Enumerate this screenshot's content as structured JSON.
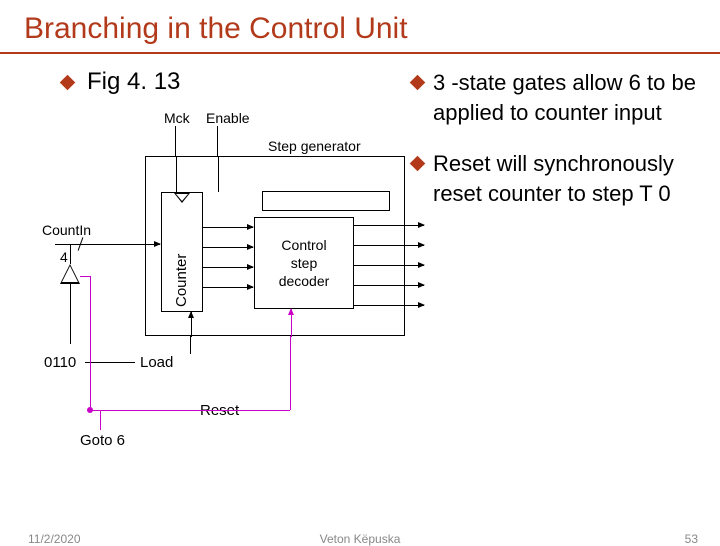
{
  "title": "Branching in the Control Unit",
  "fig_label": "Fig 4. 13",
  "diagram": {
    "mck": "Mck",
    "enable": "Enable",
    "step_generator": "Step generator",
    "counter": "Counter",
    "count_in": "CountIn",
    "four": "4",
    "decoder_l1": "Control",
    "decoder_l2": "step",
    "decoder_l3": "decoder",
    "load": "Load",
    "value_0110": "0110",
    "reset": "Reset",
    "goto6": "Goto 6"
  },
  "bullets": [
    "3 -state gates allow 6 to be applied to counter input",
    "Reset will synchronously reset counter to step T 0"
  ],
  "footer": {
    "date": "11/2/2020",
    "author": "Veton Këpuska",
    "page": "53"
  }
}
